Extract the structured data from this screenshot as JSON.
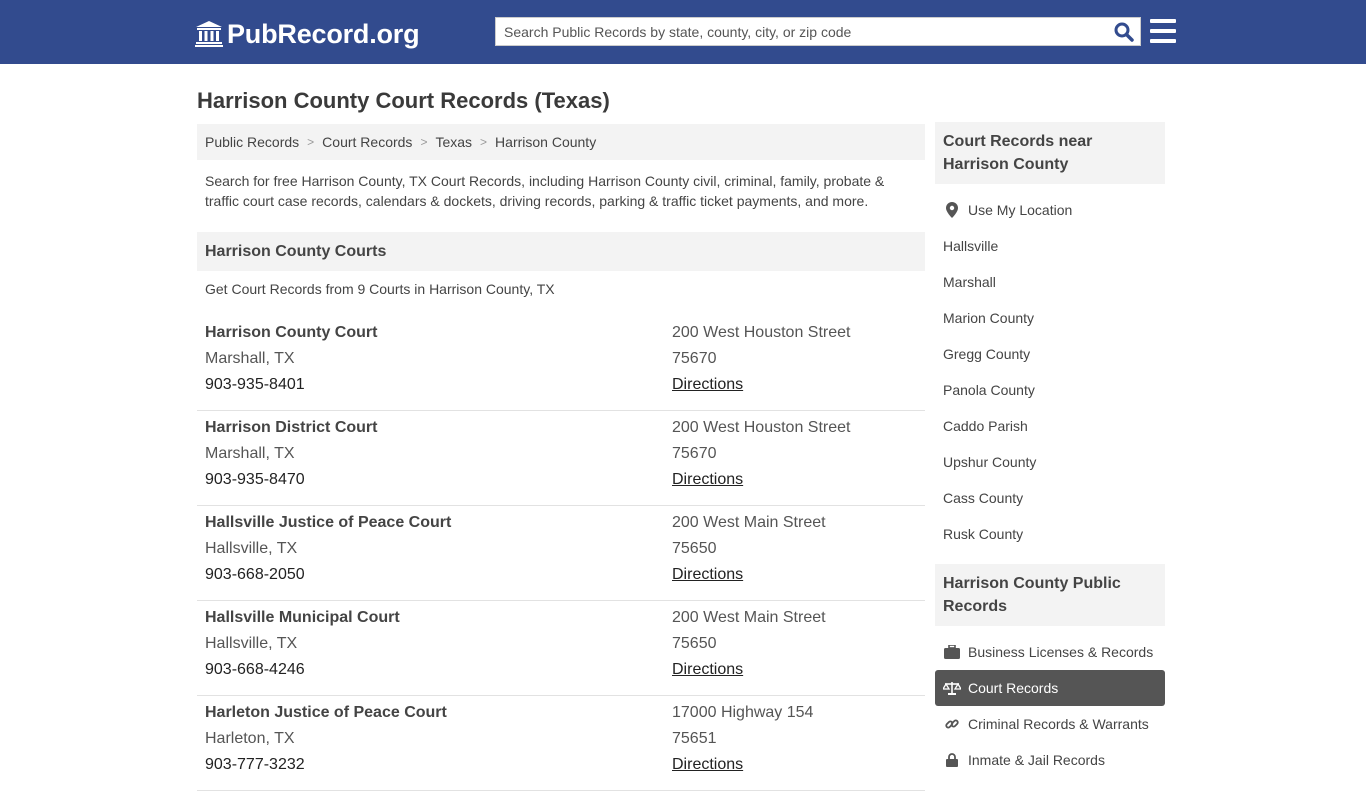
{
  "header": {
    "logo_text": "PubRecord.org",
    "search_placeholder": "Search Public Records by state, county, city, or zip code"
  },
  "page_title": "Harrison County Court Records (Texas)",
  "breadcrumb": [
    "Public Records",
    "Court Records",
    "Texas",
    "Harrison County"
  ],
  "intro": "Search for free Harrison County, TX Court Records, including Harrison County civil, criminal, family, probate & traffic court case records, calendars & dockets, driving records, parking & traffic ticket payments, and more.",
  "courts_section": {
    "title": "Harrison County Courts",
    "count_text": "Get Court Records from 9 Courts in Harrison County, TX",
    "courts": [
      {
        "name": "Harrison County Court",
        "city": "Marshall, TX",
        "phone": "903-935-8401",
        "address": "200 West Houston Street",
        "zip": "75670",
        "directions": "Directions"
      },
      {
        "name": "Harrison District Court",
        "city": "Marshall, TX",
        "phone": "903-935-8470",
        "address": "200 West Houston Street",
        "zip": "75670",
        "directions": "Directions"
      },
      {
        "name": "Hallsville Justice of Peace Court",
        "city": "Hallsville, TX",
        "phone": "903-668-2050",
        "address": "200 West Main Street",
        "zip": "75650",
        "directions": "Directions"
      },
      {
        "name": "Hallsville Municipal Court",
        "city": "Hallsville, TX",
        "phone": "903-668-4246",
        "address": "200 West Main Street",
        "zip": "75650",
        "directions": "Directions"
      },
      {
        "name": "Harleton Justice of Peace Court",
        "city": "Harleton, TX",
        "phone": "903-777-3232",
        "address": "17000 Highway 154",
        "zip": "75651",
        "directions": "Directions"
      }
    ]
  },
  "sidebar": {
    "nearby_title": "Court Records near Harrison County",
    "use_location": "Use My Location",
    "nearby": [
      "Hallsville",
      "Marshall",
      "Marion County",
      "Gregg County",
      "Panola County",
      "Caddo Parish",
      "Upshur County",
      "Cass County",
      "Rusk County"
    ],
    "public_title": "Harrison County Public Records",
    "public_records": [
      {
        "label": "Business Licenses & Records",
        "icon": "briefcase-icon",
        "active": false
      },
      {
        "label": "Court Records",
        "icon": "scales-icon",
        "active": true
      },
      {
        "label": "Criminal Records & Warrants",
        "icon": "link-icon",
        "active": false
      },
      {
        "label": "Inmate & Jail Records",
        "icon": "lock-icon",
        "active": false
      }
    ]
  },
  "colors": {
    "header_bg": "#324b8e",
    "search_icon": "#324b8e",
    "active_item_bg": "#555555"
  }
}
